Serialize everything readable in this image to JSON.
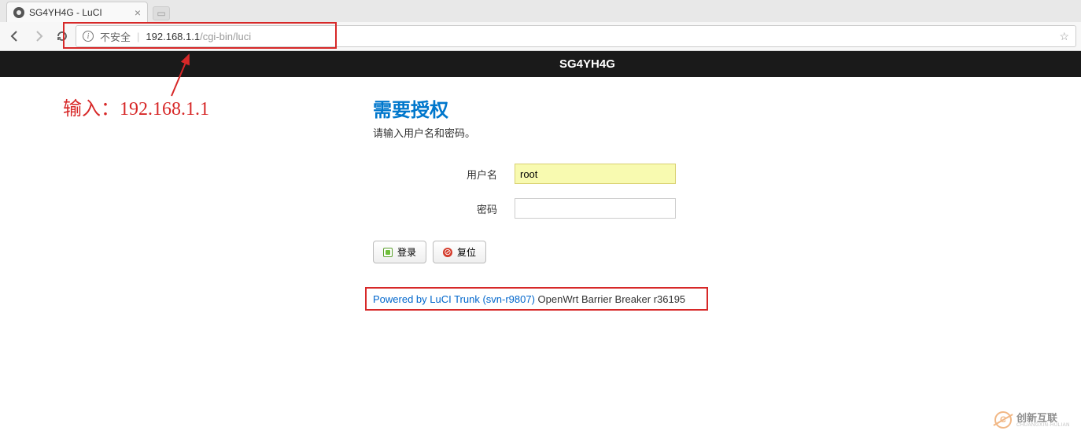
{
  "browser": {
    "tab_title": "SG4YH4G - LuCI",
    "url_insecure_label": "不安全",
    "url": "192.168.1.1/cgi-bin/luci",
    "url_ghost": "/cgi-bin/luci"
  },
  "annotation": {
    "input_hint": "输入：192.168.1.1"
  },
  "page": {
    "header_title": "SG4YH4G",
    "title": "需要授权",
    "subtitle": "请输入用户名和密码。",
    "form": {
      "username_label": "用户名",
      "username_value": "root",
      "password_label": "密码",
      "password_value": ""
    },
    "buttons": {
      "login": "登录",
      "reset": "复位"
    },
    "footer": {
      "link_text": "Powered by LuCI Trunk (svn-r9807)",
      "rest_text": " OpenWrt Barrier Breaker r36195"
    }
  },
  "watermark": {
    "cn": "创新互联",
    "py": "CHUANGXIN-HULIAN"
  }
}
